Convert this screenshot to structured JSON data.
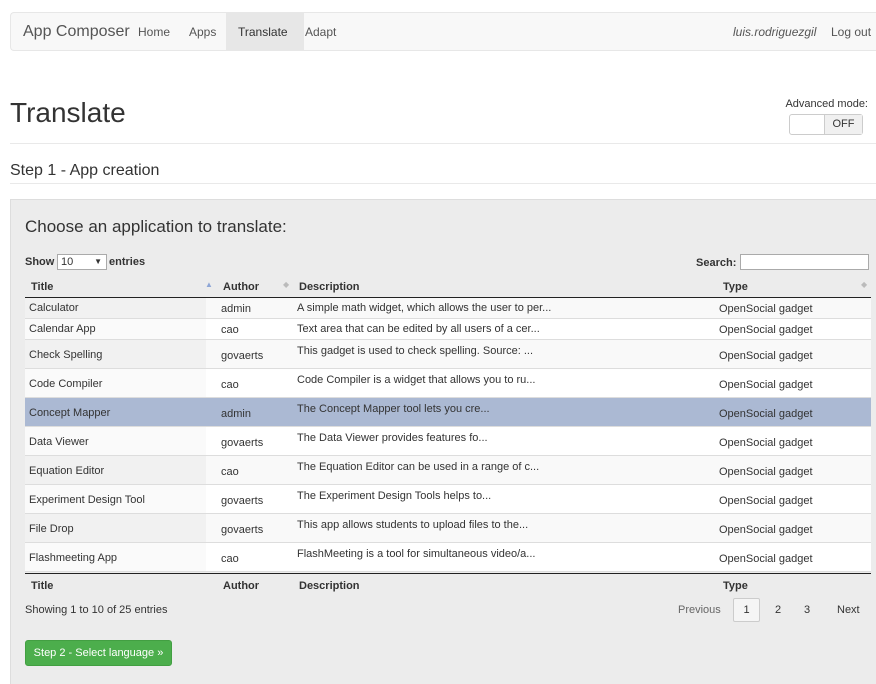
{
  "navbar": {
    "brand": "App Composer",
    "links": [
      "Home",
      "Apps",
      "Translate",
      "Adapt"
    ],
    "active": "Translate",
    "user": "luis.rodriguezgil",
    "logout": "Log out"
  },
  "header": {
    "title": "Translate",
    "advanced_label": "Advanced mode:",
    "toggle_state": "OFF"
  },
  "step": {
    "title": "Step 1 - App creation"
  },
  "panel": {
    "title": "Choose an application to translate:",
    "show_label": "Show",
    "page_size": "10",
    "entries_label": "entries",
    "search_label": "Search:",
    "search_value": ""
  },
  "table": {
    "columns": [
      "Title",
      "Author",
      "Description",
      "Type"
    ],
    "rows": [
      {
        "title": "Calculator",
        "author": "admin",
        "description": "A simple math widget, which allows the user to per...",
        "type": "OpenSocial gadget"
      },
      {
        "title": "Calendar App",
        "author": "cao",
        "description": "Text area that can be edited by all users of a cer...",
        "type": "OpenSocial gadget"
      },
      {
        "title": "Check Spelling",
        "author": "govaerts",
        "description": "This gadget is used to check spelling. Source: ...",
        "type": "OpenSocial gadget"
      },
      {
        "title": "Code Compiler",
        "author": "cao",
        "description": "Code Compiler is a widget that allows you to ru...",
        "type": "OpenSocial gadget"
      },
      {
        "title": "Concept Mapper",
        "author": "admin",
        "description": "The Concept Mapper tool lets you cre...",
        "type": "OpenSocial gadget"
      },
      {
        "title": "Data Viewer",
        "author": "govaerts",
        "description": "The Data Viewer provides features fo...",
        "type": "OpenSocial gadget"
      },
      {
        "title": "Equation Editor",
        "author": "cao",
        "description": "The Equation Editor can be used in a range of c...",
        "type": "OpenSocial gadget"
      },
      {
        "title": "Experiment Design Tool",
        "author": "govaerts",
        "description": "The Experiment Design Tools helps to...",
        "type": "OpenSocial gadget"
      },
      {
        "title": "File Drop",
        "author": "govaerts",
        "description": "This app allows students to upload files to the...",
        "type": "OpenSocial gadget"
      },
      {
        "title": "Flashmeeting App",
        "author": "cao",
        "description": "FlashMeeting is a tool for simultaneous video/a...",
        "type": "OpenSocial gadget"
      }
    ],
    "selected_row": 4
  },
  "footer": {
    "info": "Showing 1 to 10 of 25 entries",
    "previous": "Previous",
    "pages": [
      "1",
      "2",
      "3"
    ],
    "current_page": "1",
    "next": "Next",
    "next_step_button": "Step 2 - Select language »"
  },
  "colors": {
    "selected_row": "#abb9d3",
    "success_button": "#4cae4c",
    "panel_bg": "#ececec"
  }
}
